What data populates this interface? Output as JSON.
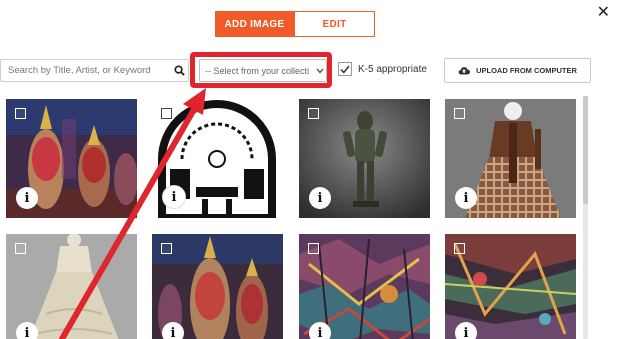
{
  "tabs": [
    {
      "label": "ADD IMAGE",
      "active": true
    },
    {
      "label": "EDIT",
      "active": false
    }
  ],
  "close_glyph": "✕",
  "search": {
    "placeholder": "Search by Title, Artist, or Keyword",
    "value": "",
    "icon": "search-icon"
  },
  "collection_select": {
    "selected": "-- Select from your collecti",
    "icon": "chevron-down-icon"
  },
  "k5": {
    "label": "K-5 appropriate",
    "checked": true
  },
  "upload": {
    "label": "UPLOAD FROM COMPUTER",
    "icon": "cloud-upload-icon"
  },
  "images": [
    {
      "subject": "thai-dancers"
    },
    {
      "subject": "architectural-plan"
    },
    {
      "subject": "bronze-sculpture"
    },
    {
      "subject": "brown-plaid-dress"
    },
    {
      "subject": "white-gown"
    },
    {
      "subject": "thai-dancers-2"
    },
    {
      "subject": "abstract-painting"
    },
    {
      "subject": "colorful-painting"
    }
  ],
  "info_glyph": "i",
  "colors": {
    "accent": "#f15a29",
    "highlight": "#e0252e"
  }
}
